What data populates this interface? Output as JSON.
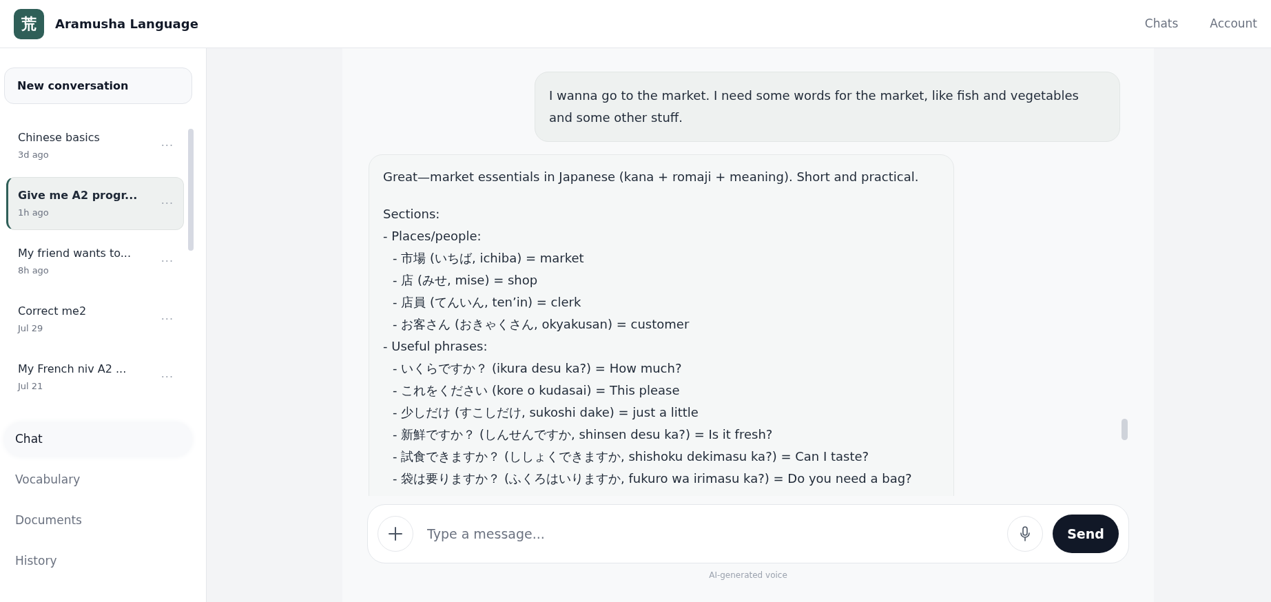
{
  "app": {
    "logo_glyph": "荒",
    "title": "Aramusha Language"
  },
  "top_nav": [
    {
      "label": "Chats"
    },
    {
      "label": "Account"
    }
  ],
  "sidebar": {
    "new_button": "New conversation",
    "conversations": [
      {
        "title": "Chinese basics",
        "time": "3d ago",
        "selected": false
      },
      {
        "title": "Give me A2 progr...",
        "time": "1h ago",
        "selected": true
      },
      {
        "title": "My friend wants to...",
        "time": "8h ago",
        "selected": false
      },
      {
        "title": "Correct me2",
        "time": "Jul 29",
        "selected": false
      },
      {
        "title": "My French niv A2 ...",
        "time": "Jul 21",
        "selected": false
      }
    ],
    "more_glyph": "···",
    "nav": [
      {
        "label": "Chat",
        "selected": true
      },
      {
        "label": "Vocabulary",
        "selected": false
      },
      {
        "label": "Documents",
        "selected": false
      },
      {
        "label": "History",
        "selected": false
      }
    ]
  },
  "messages": [
    {
      "kind": "user",
      "text": "I wanna go to the market. I need some words for the market, like fish and vegetables and some other stuff."
    },
    {
      "kind": "assistant",
      "intro": "Great—market essentials in Japanese (kana + romaji + meaning). Short and practical.",
      "heading": "Sections:",
      "items": [
        {
          "text": "- Places/people:",
          "children": [
            {
              "text": "- 市場 (いちば, ichiba) = market"
            },
            {
              "text": "- 店 (みせ, mise) = shop"
            },
            {
              "text": "- 店員 (てんいん, ten’in) = clerk"
            },
            {
              "text": "- お客さん (おきゃくさん, okyakusan) = customer"
            }
          ]
        },
        {
          "text": "- Useful phrases:",
          "children": [
            {
              "text": "- いくらですか？ (ikura desu ka?) = How much?"
            },
            {
              "text": "- これをください (kore o kudasai) = This please"
            },
            {
              "text": "- 少しだけ (すこしだけ, sukoshi dake) = just a little"
            },
            {
              "text": "- 新鮮ですか？ (しんせんですか, shinsen desu ka?) = Is it fresh?"
            },
            {
              "text": "- 試食できますか？ (ししょくできますか, shishoku dekimasu ka?) = Can I taste?"
            },
            {
              "text": "- 袋は要りますか？ (ふくろはいりますか, fukuro wa irimasu ka?) = Do you need a bag?"
            }
          ]
        }
      ]
    }
  ],
  "composer": {
    "placeholder": "Type a message...",
    "send": "Send",
    "note": "AI-generated voice"
  }
}
